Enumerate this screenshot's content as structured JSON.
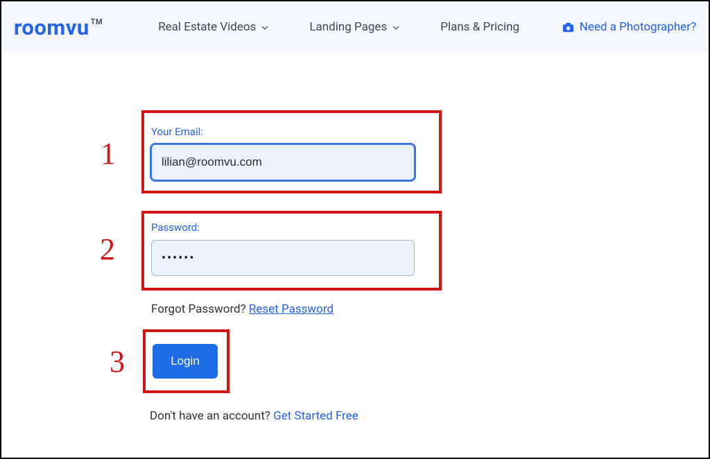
{
  "header": {
    "logo": "roomvu",
    "logo_tm": "TM",
    "nav": [
      {
        "label": "Real Estate Videos"
      },
      {
        "label": "Landing Pages"
      },
      {
        "label": "Plans & Pricing"
      }
    ],
    "photographer_label": "Need a Photographer?"
  },
  "form": {
    "email_label": "Your Email:",
    "email_value": "lilian@roomvu.com",
    "password_label": "Password:",
    "password_mask": "••••••",
    "forgot_text": "Forgot Password? ",
    "reset_link": " Reset Password",
    "login_label": "Login",
    "signup_text": "Don't have an account? ",
    "signup_link": "Get Started Free"
  },
  "annotations": [
    "1",
    "2",
    "3"
  ],
  "colors": {
    "brand_blue": "#2563eb",
    "header_bg": "#f4f7ff",
    "input_bg": "#eaf2fd",
    "annotation_red": "#d11414"
  }
}
